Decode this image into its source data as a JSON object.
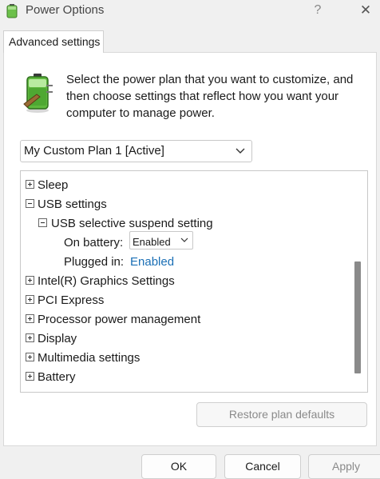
{
  "window": {
    "title": "Power Options",
    "help_glyph": "?",
    "close_glyph": "✕",
    "icon": "power-battery-icon"
  },
  "tabs": [
    {
      "label": "Advanced settings",
      "selected": true
    }
  ],
  "description": "Select the power plan that you want to customize, and then choose settings that reflect how you want your computer to manage power.",
  "plan_select": {
    "value": "My Custom Plan 1 [Active]"
  },
  "tree": {
    "items": [
      {
        "label": "Sleep",
        "expanded": false
      },
      {
        "label": "USB settings",
        "expanded": true
      },
      {
        "label": "USB selective suspend setting",
        "expanded": true
      },
      {
        "label": "On battery:",
        "value": "Enabled",
        "control": "dropdown"
      },
      {
        "label": "Plugged in:",
        "value": "Enabled",
        "control": "link"
      },
      {
        "label": "Intel(R) Graphics Settings",
        "expanded": false
      },
      {
        "label": "PCI Express",
        "expanded": false
      },
      {
        "label": "Processor power management",
        "expanded": false
      },
      {
        "label": "Display",
        "expanded": false
      },
      {
        "label": "Multimedia settings",
        "expanded": false
      },
      {
        "label": "Battery",
        "expanded": false
      }
    ]
  },
  "buttons": {
    "restore": "Restore plan defaults",
    "ok": "OK",
    "cancel": "Cancel",
    "apply": "Apply"
  },
  "colors": {
    "link": "#1a6fb5",
    "battery_green": "#6cc04a"
  }
}
